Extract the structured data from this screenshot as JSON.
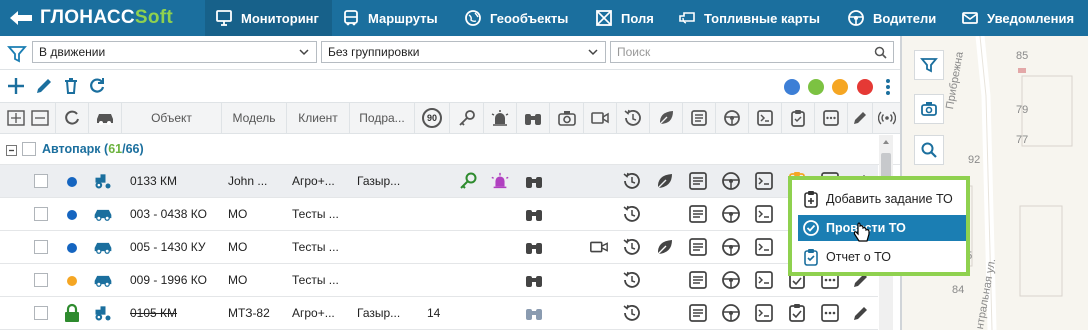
{
  "app": {
    "logo_main": "ГЛОНАСС",
    "logo_accent": "Soft",
    "brand_color": "#1b6f9e",
    "accent_color": "#8fd14f"
  },
  "nav": {
    "items": [
      {
        "label": "Мониторинг",
        "icon": "monitor-icon",
        "active": true
      },
      {
        "label": "Маршруты",
        "icon": "bus-icon"
      },
      {
        "label": "Геообъекты",
        "icon": "globe-icon"
      },
      {
        "label": "Поля",
        "icon": "field-icon"
      },
      {
        "label": "Топливные карты",
        "icon": "fuel-card-icon"
      },
      {
        "label": "Водители",
        "icon": "steering-wheel-icon"
      },
      {
        "label": "Уведомления",
        "icon": "mail-icon"
      }
    ]
  },
  "filters": {
    "status_value": "В движении",
    "grouping_value": "Без группировки",
    "search_placeholder": "Поиск"
  },
  "columns": {
    "object": "Объект",
    "model": "Модель",
    "client": "Клиент",
    "division": "Подра...",
    "speed_badge": "90"
  },
  "group": {
    "name": "Автопарк",
    "open": "(",
    "active_count": "61",
    "sep": "/",
    "total_count": "66",
    "close": ")"
  },
  "rows": [
    {
      "object": "0133 КМ",
      "model": "John ...",
      "client": "Агро+...",
      "division": "Газыр...",
      "extra": "",
      "status_color": "#1565c0",
      "vehicle": "tractor-icon",
      "selected": true
    },
    {
      "object": "003 - 0438 КО",
      "model": "МО",
      "client": "Тесты ...",
      "division": "",
      "extra": "",
      "status_color": "#1565c0",
      "vehicle": "car-icon"
    },
    {
      "object": "005 - 1430 КУ",
      "model": "МО",
      "client": "Тесты ...",
      "division": "",
      "extra": "",
      "status_color": "#1565c0",
      "vehicle": "car-icon"
    },
    {
      "object": "009 - 1996 КО",
      "model": "МО",
      "client": "Тесты ...",
      "division": "",
      "extra": "",
      "status_color": "#f5a623",
      "vehicle": "car-icon"
    },
    {
      "object": "0105 КМ",
      "model": "МТЗ-82",
      "client": "Агро+...",
      "division": "Газыр...",
      "extra": "14",
      "status_color": "#2e7d32",
      "vehicle": "tractor-icon",
      "strike": true
    }
  ],
  "popup": {
    "add_task": "Добавить задание ТО",
    "do_service": "Провести ТО",
    "report": "Отчет о ТО"
  },
  "map": {
    "street1": "Прибрежна",
    "street2": "нтральная ул.",
    "numbers": [
      "85",
      "79",
      "77",
      "92",
      "75",
      "84"
    ]
  }
}
